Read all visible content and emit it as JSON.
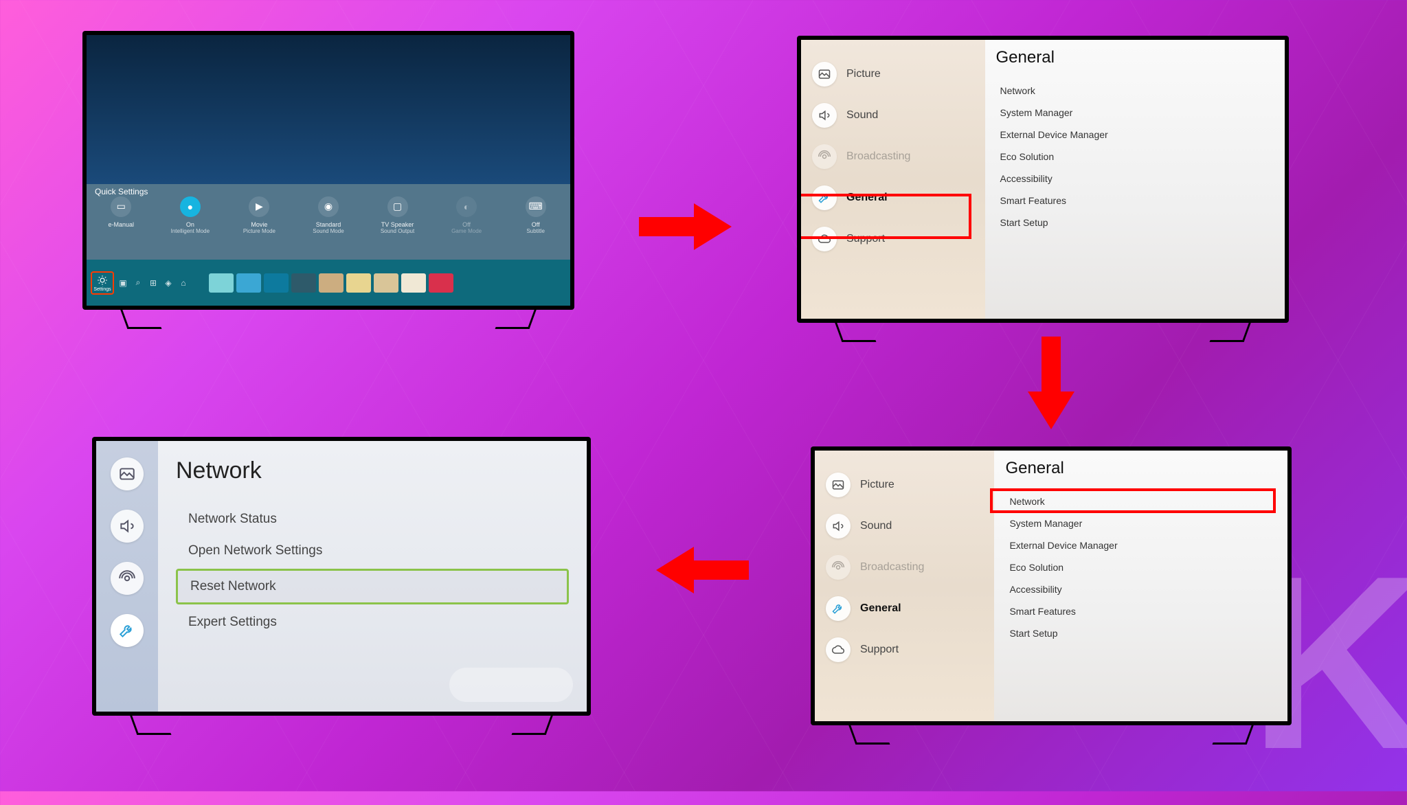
{
  "step1": {
    "quick_settings_label": "Quick Settings",
    "items": [
      {
        "label": "e-Manual",
        "sub": ""
      },
      {
        "label": "On",
        "sub": "Intelligent Mode"
      },
      {
        "label": "Movie",
        "sub": "Picture Mode"
      },
      {
        "label": "Standard",
        "sub": "Sound Mode"
      },
      {
        "label": "TV Speaker",
        "sub": "Sound Output"
      },
      {
        "label": "Off",
        "sub": "Game Mode"
      },
      {
        "label": "Off",
        "sub": "Subtitle"
      }
    ],
    "settings_label": "Settings"
  },
  "step2": {
    "side": [
      "Picture",
      "Sound",
      "Broadcasting",
      "General",
      "Support"
    ],
    "title": "General",
    "items": [
      "Network",
      "System Manager",
      "External Device Manager",
      "Eco Solution",
      "Accessibility",
      "Smart Features",
      "Start Setup"
    ]
  },
  "step3": {
    "side": [
      "Picture",
      "Sound",
      "Broadcasting",
      "General",
      "Support"
    ],
    "title": "General",
    "items": [
      "Network",
      "System Manager",
      "External Device Manager",
      "Eco Solution",
      "Accessibility",
      "Smart Features",
      "Start Setup"
    ]
  },
  "step4": {
    "title": "Network",
    "items": [
      "Network Status",
      "Open Network Settings",
      "Reset Network",
      "Expert Settings"
    ]
  }
}
